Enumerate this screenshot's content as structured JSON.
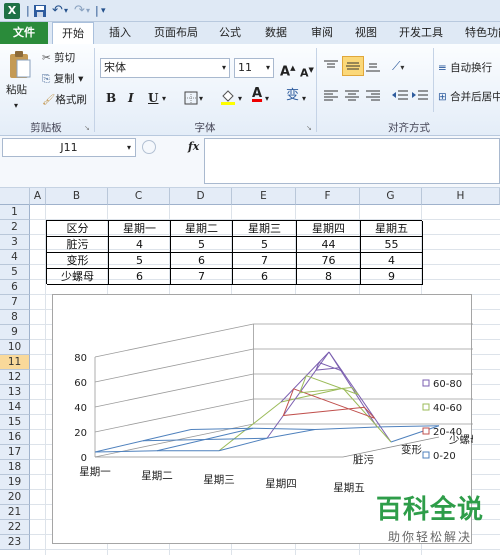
{
  "app": {
    "logo": "X"
  },
  "qat": {
    "save_icon": "save-icon",
    "undo": "↶",
    "redo": "↷",
    "customize": "▾"
  },
  "tabs": [
    "文件",
    "开始",
    "插入",
    "页面布局",
    "公式",
    "数据",
    "审阅",
    "视图",
    "开发工具",
    "特色功能"
  ],
  "active_tab": "开始",
  "ribbon": {
    "clipboard": {
      "paste": "粘贴",
      "cut": "剪切",
      "copy": "复制",
      "format_painter": "格式刷",
      "label": "剪贴板"
    },
    "font": {
      "family": "宋体",
      "size": "11",
      "grow": "A",
      "shrink": "A",
      "bold": "B",
      "italic": "I",
      "underline": "U",
      "pinyin": "变",
      "label": "字体"
    },
    "alignment": {
      "wrap": "自动换行",
      "merge": "合并后居中",
      "label": "对齐方式"
    }
  },
  "formula_bar": {
    "name_box": "J11",
    "fx": "fx",
    "value": ""
  },
  "columns": [
    "A",
    "B",
    "C",
    "D",
    "E",
    "F",
    "G",
    "H"
  ],
  "rows": [
    "1",
    "2",
    "3",
    "4",
    "5",
    "6",
    "7",
    "8",
    "9",
    "10",
    "11",
    "12",
    "13",
    "14",
    "15",
    "16",
    "17",
    "18",
    "19",
    "20",
    "21",
    "22",
    "23"
  ],
  "selected_row": "11",
  "table": {
    "header": [
      "区分",
      "星期一",
      "星期二",
      "星期三",
      "星期四",
      "星期五"
    ],
    "rows": [
      [
        "脏污",
        "4",
        "5",
        "5",
        "44",
        "55"
      ],
      [
        "变形",
        "5",
        "6",
        "7",
        "76",
        "4"
      ],
      [
        "少螺母",
        "6",
        "7",
        "6",
        "8",
        "9"
      ]
    ]
  },
  "chart_data": {
    "type": "surface",
    "categories": [
      "星期一",
      "星期二",
      "星期三",
      "星期四",
      "星期五"
    ],
    "series": [
      {
        "name": "脏污",
        "values": [
          4,
          5,
          5,
          44,
          55
        ]
      },
      {
        "name": "变形",
        "values": [
          5,
          6,
          7,
          76,
          4
        ]
      },
      {
        "name": "少螺母",
        "values": [
          6,
          7,
          6,
          8,
          9
        ]
      }
    ],
    "z_ticks": [
      "0",
      "20",
      "40",
      "60",
      "80"
    ],
    "zlim": [
      0,
      80
    ],
    "legend": [
      {
        "label": "60-80",
        "color": "#7b5fb0"
      },
      {
        "label": "40-60",
        "color": "#9bbb59"
      },
      {
        "label": "20-40",
        "color": "#c0504d"
      },
      {
        "label": "0-20",
        "color": "#4f81bd"
      }
    ],
    "legend_position": "right"
  },
  "watermark": {
    "title": "百科全说",
    "subtitle": "助你轻松解决"
  }
}
